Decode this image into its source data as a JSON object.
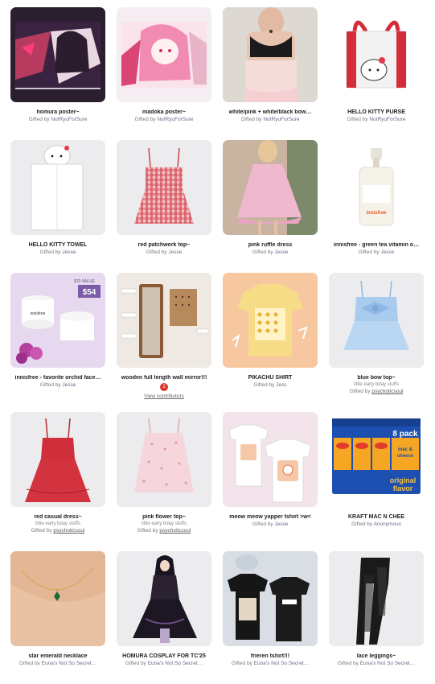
{
  "gifted_prefix": "Gifted by",
  "items": [
    {
      "title": "homura poster~",
      "user": "NotRyuForSure"
    },
    {
      "title": "madoka poster~",
      "user": "NotRyuForSure"
    },
    {
      "title": "white/pink + white/black bow…",
      "user": "NotRyuForSure"
    },
    {
      "title": "HELLO KITTY PURSE",
      "user": "NotRyuForSure"
    },
    {
      "title": "HELLO KITTY TOWEL",
      "user": "Jesse"
    },
    {
      "title": "red patchwork top~",
      "user": "Jesse"
    },
    {
      "title": "pink ruffle dress",
      "user": "Jesse"
    },
    {
      "title": "innisfree - green tea vitamin o…",
      "user": "Jesse"
    },
    {
      "title": "innisfree - favorite orchid face…",
      "user": "Jesse"
    },
    {
      "title": "wooden full length wall mirror!!!",
      "contrib_count": "2",
      "view_contributors": "View contributors"
    },
    {
      "title": "PIKACHU SHIRT",
      "user": "Jess"
    },
    {
      "title": "blue bow top~",
      "note": "little early bday stuffs",
      "user": "psychoticsoul"
    },
    {
      "title": "red casual dress~",
      "note": "little early bday stuffs",
      "user": "psychoticsoul"
    },
    {
      "title": "pink flower top~",
      "note": "little early bday stuffs",
      "user": "psychoticsoul"
    },
    {
      "title": "meow meow yapper tshirt >w<",
      "user": "Jesse"
    },
    {
      "title": "KRAFT MAC N CHEE",
      "user": "Anonymous"
    },
    {
      "title": "star emerald necklace",
      "user": "Euna's Not So Secret…"
    },
    {
      "title": "HOMURA COSPLAY FOR TC'25",
      "user": "Euna's Not So Secret…"
    },
    {
      "title": "frieren tshirt!!!",
      "user": "Euna's Not So Secret…"
    },
    {
      "title": "lace leggings~",
      "user": "Euna's Not So Secret…"
    }
  ],
  "image_text": {
    "innisfree_price_label": "$70 VALUE",
    "innisfree_price": "$54",
    "innisfree_brand": "innisfree",
    "kraft_pack": "8 pack",
    "kraft_brand": "Kraft",
    "kraft_line1": "mac &",
    "kraft_line2": "cheese",
    "kraft_flavor1": "original",
    "kraft_flavor2": "flavor"
  },
  "colors": {
    "tile_bg": "#ececee",
    "title": "#1f1f1f",
    "muted": "#7b7b7b",
    "contrib_badge": "#e0342a",
    "kraft_blue": "#1d4fb0",
    "kraft_orange": "#f5a623"
  }
}
